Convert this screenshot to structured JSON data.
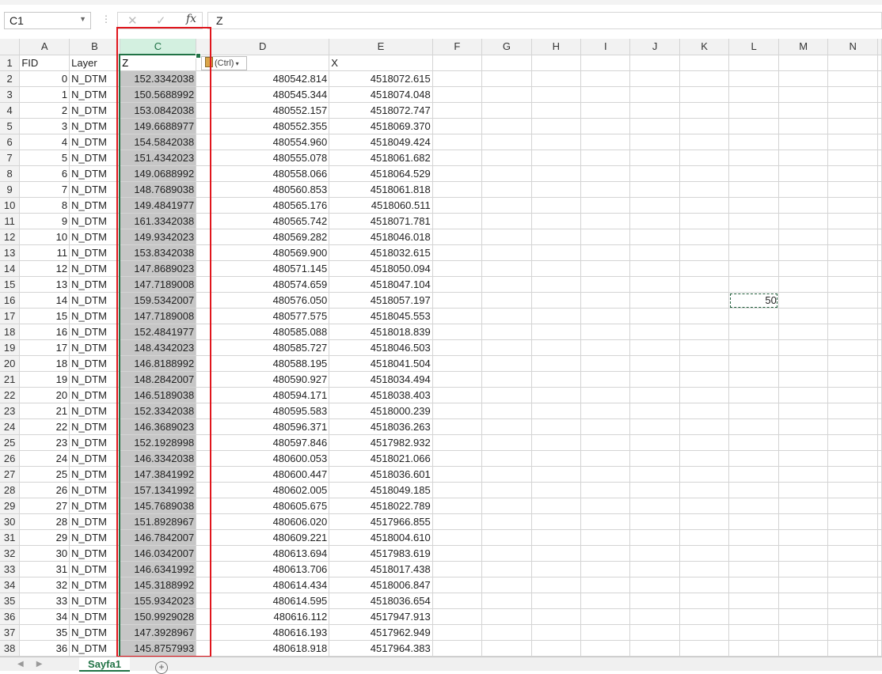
{
  "formula_bar": {
    "name_box": "C1",
    "cancel_icon": "✕",
    "enter_icon": "✓",
    "fx_label": "fx",
    "formula_value": "Z"
  },
  "columns": [
    "A",
    "B",
    "C",
    "D",
    "E",
    "F",
    "G",
    "H",
    "I",
    "J",
    "K",
    "L",
    "M",
    "N"
  ],
  "selected_column": "C",
  "header_row": {
    "A": "FID",
    "B": "Layer",
    "C": "Z",
    "D": "",
    "E": "X"
  },
  "rows": [
    {
      "n": "2",
      "fid": "0",
      "layer": "N_DTM",
      "z": "152.3342038",
      "d": "480542.814",
      "e": "4518072.615"
    },
    {
      "n": "3",
      "fid": "1",
      "layer": "N_DTM",
      "z": "150.5688992",
      "d": "480545.344",
      "e": "4518074.048"
    },
    {
      "n": "4",
      "fid": "2",
      "layer": "N_DTM",
      "z": "153.0842038",
      "d": "480552.157",
      "e": "4518072.747"
    },
    {
      "n": "5",
      "fid": "3",
      "layer": "N_DTM",
      "z": "149.6688977",
      "d": "480552.355",
      "e": "4518069.370"
    },
    {
      "n": "6",
      "fid": "4",
      "layer": "N_DTM",
      "z": "154.5842038",
      "d": "480554.960",
      "e": "4518049.424"
    },
    {
      "n": "7",
      "fid": "5",
      "layer": "N_DTM",
      "z": "151.4342023",
      "d": "480555.078",
      "e": "4518061.682"
    },
    {
      "n": "8",
      "fid": "6",
      "layer": "N_DTM",
      "z": "149.0688992",
      "d": "480558.066",
      "e": "4518064.529"
    },
    {
      "n": "9",
      "fid": "7",
      "layer": "N_DTM",
      "z": "148.7689038",
      "d": "480560.853",
      "e": "4518061.818"
    },
    {
      "n": "10",
      "fid": "8",
      "layer": "N_DTM",
      "z": "149.4841977",
      "d": "480565.176",
      "e": "4518060.511"
    },
    {
      "n": "11",
      "fid": "9",
      "layer": "N_DTM",
      "z": "161.3342038",
      "d": "480565.742",
      "e": "4518071.781"
    },
    {
      "n": "12",
      "fid": "10",
      "layer": "N_DTM",
      "z": "149.9342023",
      "d": "480569.282",
      "e": "4518046.018"
    },
    {
      "n": "13",
      "fid": "11",
      "layer": "N_DTM",
      "z": "153.8342038",
      "d": "480569.900",
      "e": "4518032.615"
    },
    {
      "n": "14",
      "fid": "12",
      "layer": "N_DTM",
      "z": "147.8689023",
      "d": "480571.145",
      "e": "4518050.094"
    },
    {
      "n": "15",
      "fid": "13",
      "layer": "N_DTM",
      "z": "147.7189008",
      "d": "480574.659",
      "e": "4518047.104"
    },
    {
      "n": "16",
      "fid": "14",
      "layer": "N_DTM",
      "z": "159.5342007",
      "d": "480576.050",
      "e": "4518057.197"
    },
    {
      "n": "17",
      "fid": "15",
      "layer": "N_DTM",
      "z": "147.7189008",
      "d": "480577.575",
      "e": "4518045.553"
    },
    {
      "n": "18",
      "fid": "16",
      "layer": "N_DTM",
      "z": "152.4841977",
      "d": "480585.088",
      "e": "4518018.839"
    },
    {
      "n": "19",
      "fid": "17",
      "layer": "N_DTM",
      "z": "148.4342023",
      "d": "480585.727",
      "e": "4518046.503"
    },
    {
      "n": "20",
      "fid": "18",
      "layer": "N_DTM",
      "z": "146.8188992",
      "d": "480588.195",
      "e": "4518041.504"
    },
    {
      "n": "21",
      "fid": "19",
      "layer": "N_DTM",
      "z": "148.2842007",
      "d": "480590.927",
      "e": "4518034.494"
    },
    {
      "n": "22",
      "fid": "20",
      "layer": "N_DTM",
      "z": "146.5189038",
      "d": "480594.171",
      "e": "4518038.403"
    },
    {
      "n": "23",
      "fid": "21",
      "layer": "N_DTM",
      "z": "152.3342038",
      "d": "480595.583",
      "e": "4518000.239"
    },
    {
      "n": "24",
      "fid": "22",
      "layer": "N_DTM",
      "z": "146.3689023",
      "d": "480596.371",
      "e": "4518036.263"
    },
    {
      "n": "25",
      "fid": "23",
      "layer": "N_DTM",
      "z": "152.1928998",
      "d": "480597.846",
      "e": "4517982.932"
    },
    {
      "n": "26",
      "fid": "24",
      "layer": "N_DTM",
      "z": "146.3342038",
      "d": "480600.053",
      "e": "4518021.066"
    },
    {
      "n": "27",
      "fid": "25",
      "layer": "N_DTM",
      "z": "147.3841992",
      "d": "480600.447",
      "e": "4518036.601"
    },
    {
      "n": "28",
      "fid": "26",
      "layer": "N_DTM",
      "z": "157.1341992",
      "d": "480602.005",
      "e": "4518049.185"
    },
    {
      "n": "29",
      "fid": "27",
      "layer": "N_DTM",
      "z": "145.7689038",
      "d": "480605.675",
      "e": "4518022.789"
    },
    {
      "n": "30",
      "fid": "28",
      "layer": "N_DTM",
      "z": "151.8928967",
      "d": "480606.020",
      "e": "4517966.855"
    },
    {
      "n": "31",
      "fid": "29",
      "layer": "N_DTM",
      "z": "146.7842007",
      "d": "480609.221",
      "e": "4518004.610"
    },
    {
      "n": "32",
      "fid": "30",
      "layer": "N_DTM",
      "z": "146.0342007",
      "d": "480613.694",
      "e": "4517983.619"
    },
    {
      "n": "33",
      "fid": "31",
      "layer": "N_DTM",
      "z": "146.6341992",
      "d": "480613.706",
      "e": "4518017.438"
    },
    {
      "n": "34",
      "fid": "32",
      "layer": "N_DTM",
      "z": "145.3188992",
      "d": "480614.434",
      "e": "4518006.847"
    },
    {
      "n": "35",
      "fid": "33",
      "layer": "N_DTM",
      "z": "155.9342023",
      "d": "480614.595",
      "e": "4518036.654"
    },
    {
      "n": "36",
      "fid": "34",
      "layer": "N_DTM",
      "z": "150.9929028",
      "d": "480616.112",
      "e": "4517947.913"
    },
    {
      "n": "37",
      "fid": "35",
      "layer": "N_DTM",
      "z": "147.3928967",
      "d": "480616.193",
      "e": "4517962.949"
    },
    {
      "n": "38",
      "fid": "36",
      "layer": "N_DTM",
      "z": "145.8757993",
      "d": "480618.918",
      "e": "4517964.383"
    }
  ],
  "copied_cell": {
    "row": "16",
    "column": "L",
    "value": "50"
  },
  "paste_options": {
    "label": "(Ctrl)"
  },
  "sheet_tabs": [
    {
      "label": "Sayfa1",
      "active": true
    }
  ],
  "add_sheet_icon": "+",
  "colors": {
    "accent": "#217346",
    "highlight_box": "#e0161d",
    "selected_fill": "#c6c6c6"
  }
}
